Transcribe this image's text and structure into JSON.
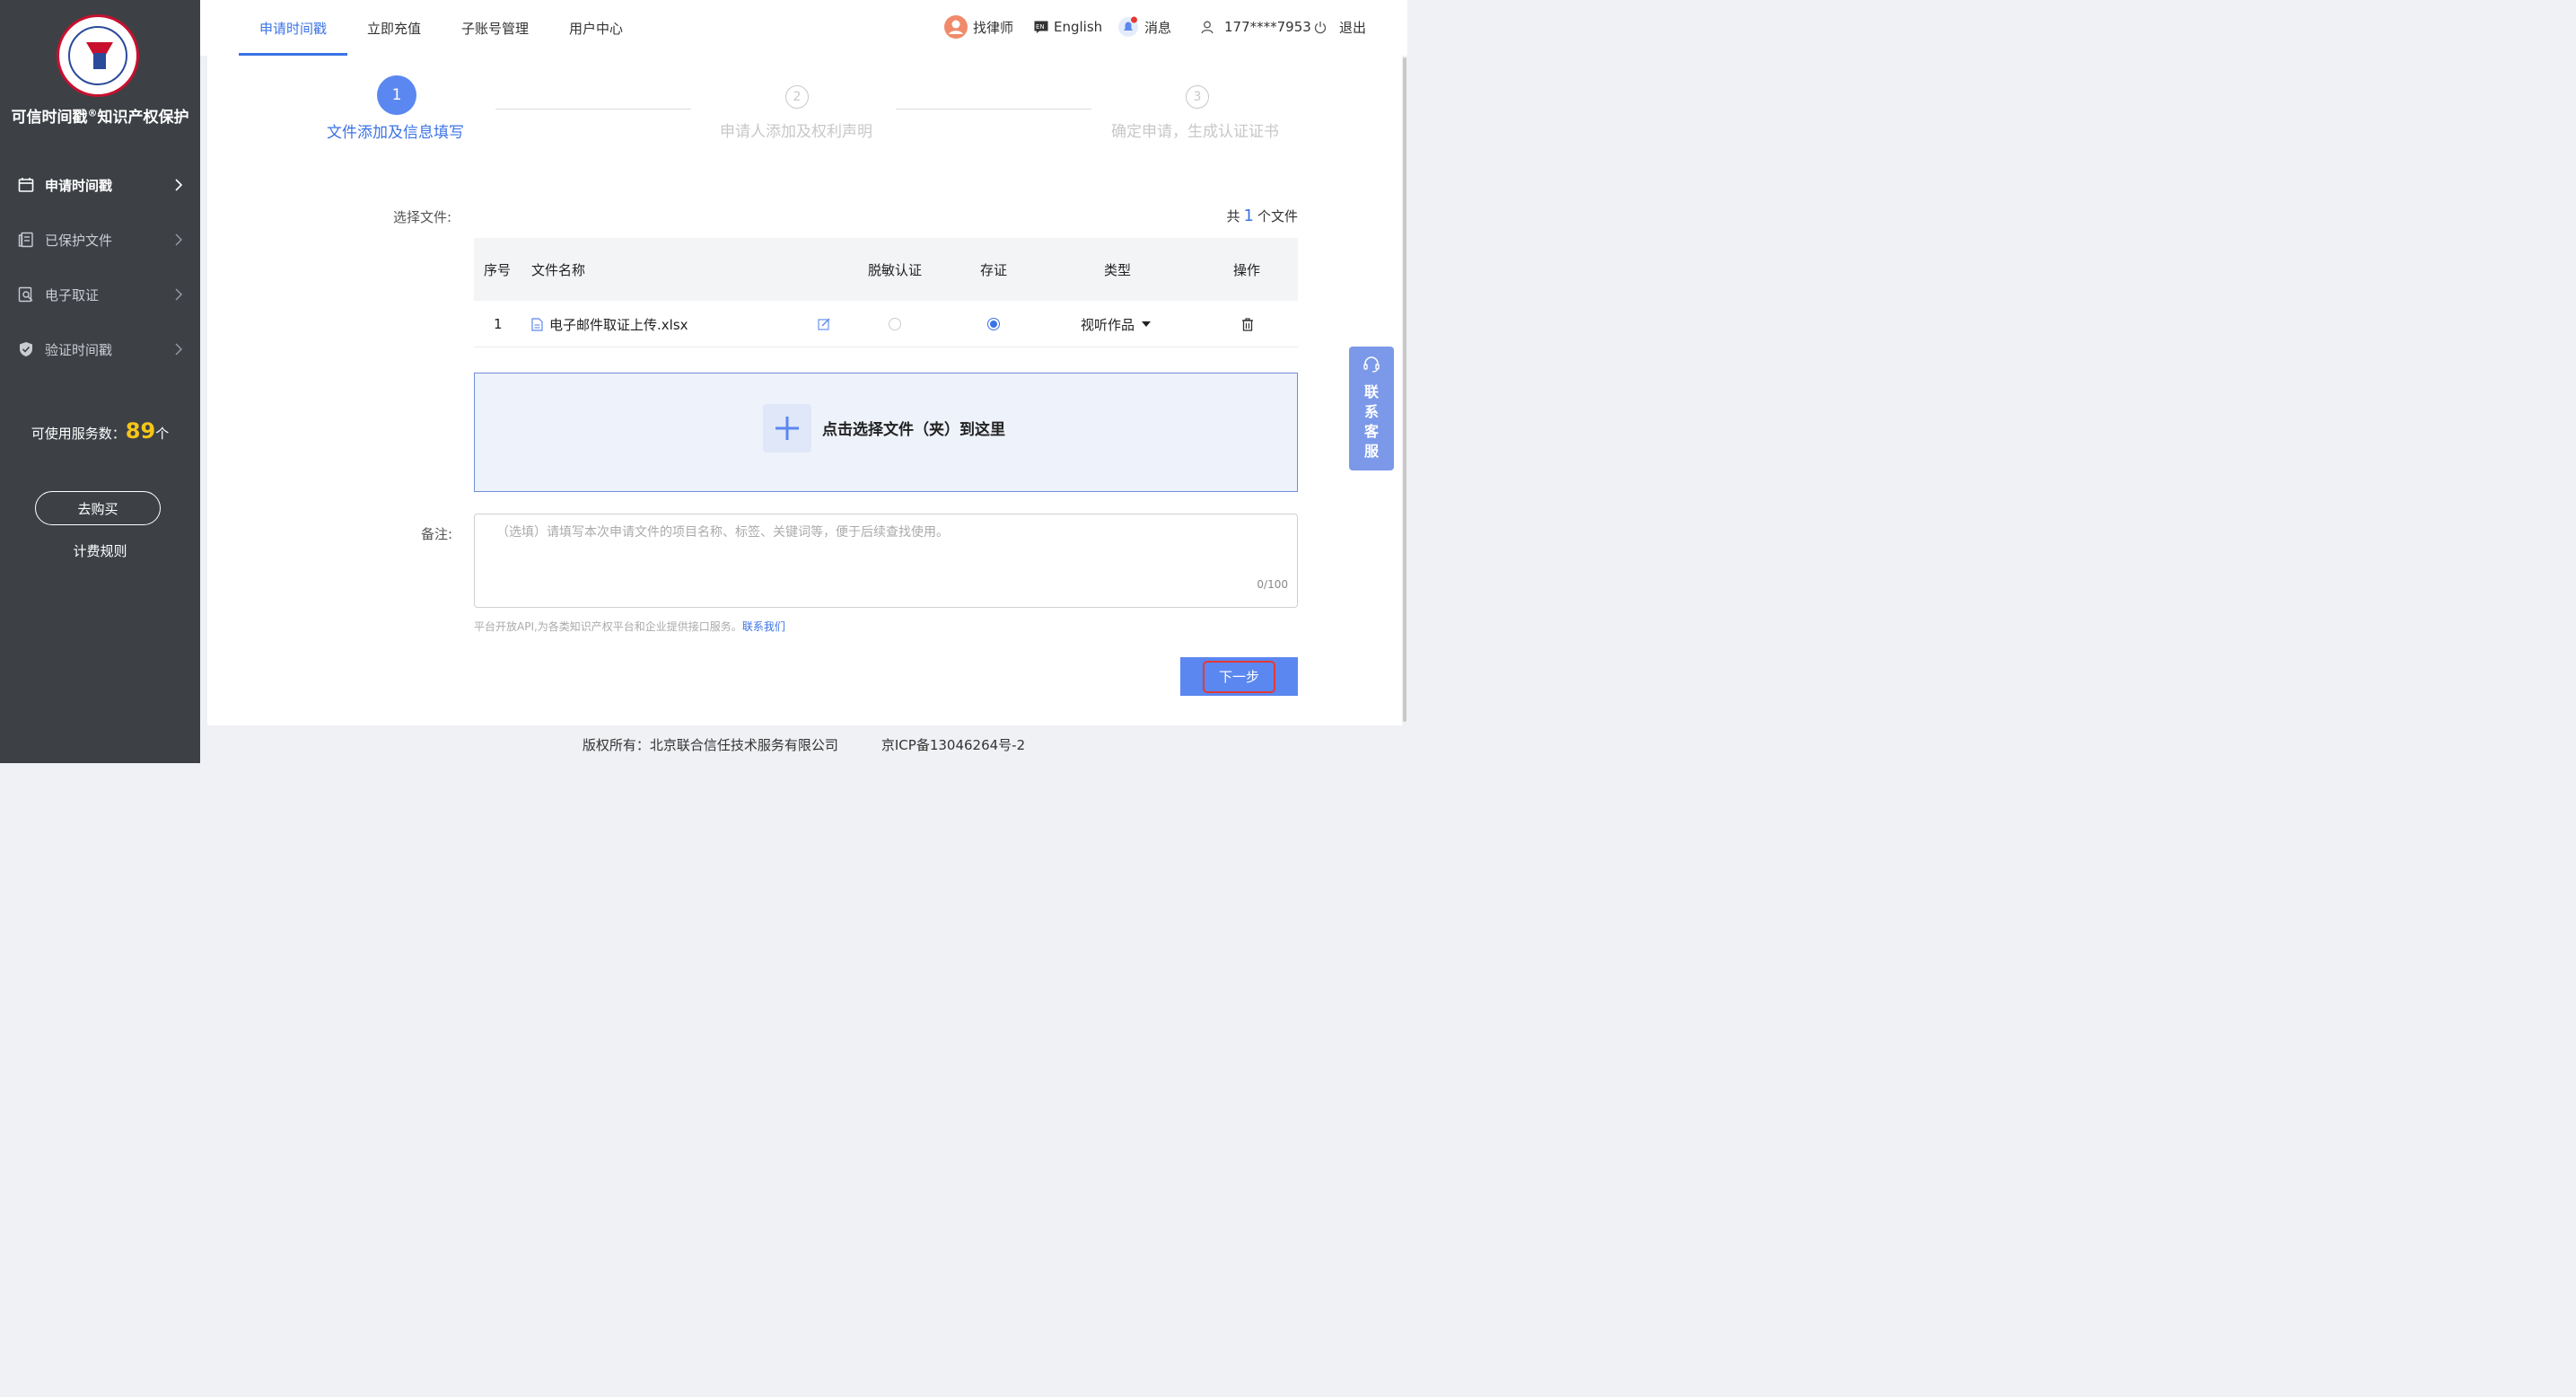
{
  "sidebar": {
    "brand": "可信时间戳",
    "brand_sup": "®",
    "brand_suffix": "知识产权保护",
    "items": [
      {
        "label": "申请时间戳",
        "icon": "calendar-icon"
      },
      {
        "label": "已保护文件",
        "icon": "documents-icon"
      },
      {
        "label": "电子取证",
        "icon": "evidence-search-icon"
      },
      {
        "label": "验证时间戳",
        "icon": "shield-check-icon"
      }
    ],
    "service_label": "可使用服务数：",
    "service_count": "89",
    "service_unit": "个",
    "buy_label": "去购买",
    "rules_label": "计费规则"
  },
  "topbar": {
    "tabs": [
      "申请时间戳",
      "立即充值",
      "子账号管理",
      "用户中心"
    ],
    "lawyer": "找律师",
    "language": "English",
    "messages": "消息",
    "user": "177****7953",
    "logout": "退出"
  },
  "steps": [
    {
      "num": "1",
      "label": "文件添加及信息填写",
      "state": "active"
    },
    {
      "num": "2",
      "label": "申请人添加及权利声明",
      "state": "todo"
    },
    {
      "num": "3",
      "label": "确定申请，生成认证证书",
      "state": "todo"
    }
  ],
  "form": {
    "select_file_label": "选择文件:",
    "total_prefix": "共",
    "total_count": "1",
    "total_suffix": "个文件",
    "table": {
      "headers": [
        "序号",
        "文件名称",
        "脱敏认证",
        "存证",
        "类型",
        "操作"
      ],
      "rows": [
        {
          "index": "1",
          "filename": "电子邮件取证上传.xlsx",
          "desensitize": false,
          "deposit": true,
          "type": "视听作品"
        }
      ]
    },
    "dropzone_text": "点击选择文件（夹）到这里",
    "remark_label": "备注:",
    "remark_placeholder": "（选填）请填写本次申请文件的项目名称、标签、关键词等，便于后续查找使用。",
    "remark_counter": "0/100",
    "api_note": "平台开放API,为各类知识产权平台和企业提供接口服务。",
    "api_link": "联系我们",
    "next_label": "下一步"
  },
  "float_service": [
    "联",
    "系",
    "客",
    "服"
  ],
  "footer": {
    "copyright": "版权所有：北京联合信任技术服务有限公司",
    "icp": "京ICP备13046264号-2"
  },
  "colors": {
    "accent": "#3b73e6",
    "sidebar_bg": "#3d4146",
    "highlight_red": "#e53935",
    "service_yellow": "#f5c518"
  }
}
